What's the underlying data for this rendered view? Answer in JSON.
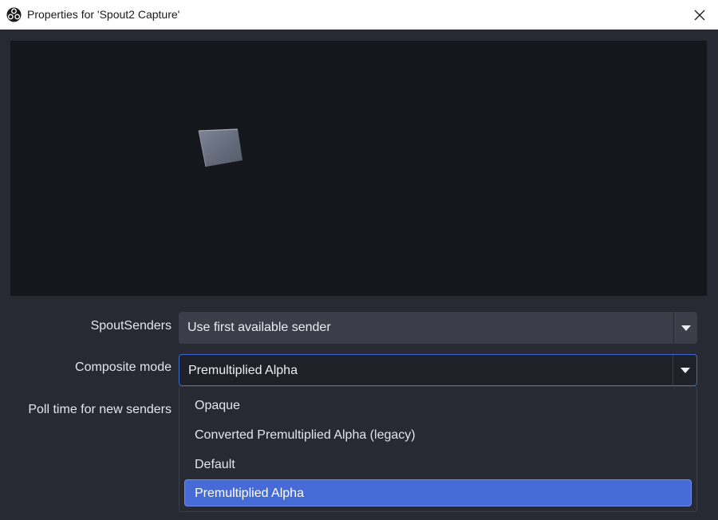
{
  "window": {
    "title": "Properties for 'Spout2 Capture'",
    "app_icon": "obs-logo-icon",
    "close_icon": "close-icon"
  },
  "preview": {
    "background": "#16171d"
  },
  "properties": [
    {
      "label": "SpoutSenders",
      "value": "Use first available sender",
      "focused": false
    },
    {
      "label": "Composite mode",
      "value": "Premultiplied Alpha",
      "focused": true
    },
    {
      "label": "Poll time for new senders"
    }
  ],
  "dropdown": {
    "options": [
      "Opaque",
      "Converted Premultiplied Alpha (legacy)",
      "Default",
      "Premultiplied Alpha"
    ],
    "selected_index": 3
  },
  "colors": {
    "accent": "#476bd6",
    "focus_border": "#3d67d1",
    "background": "#272a33"
  }
}
